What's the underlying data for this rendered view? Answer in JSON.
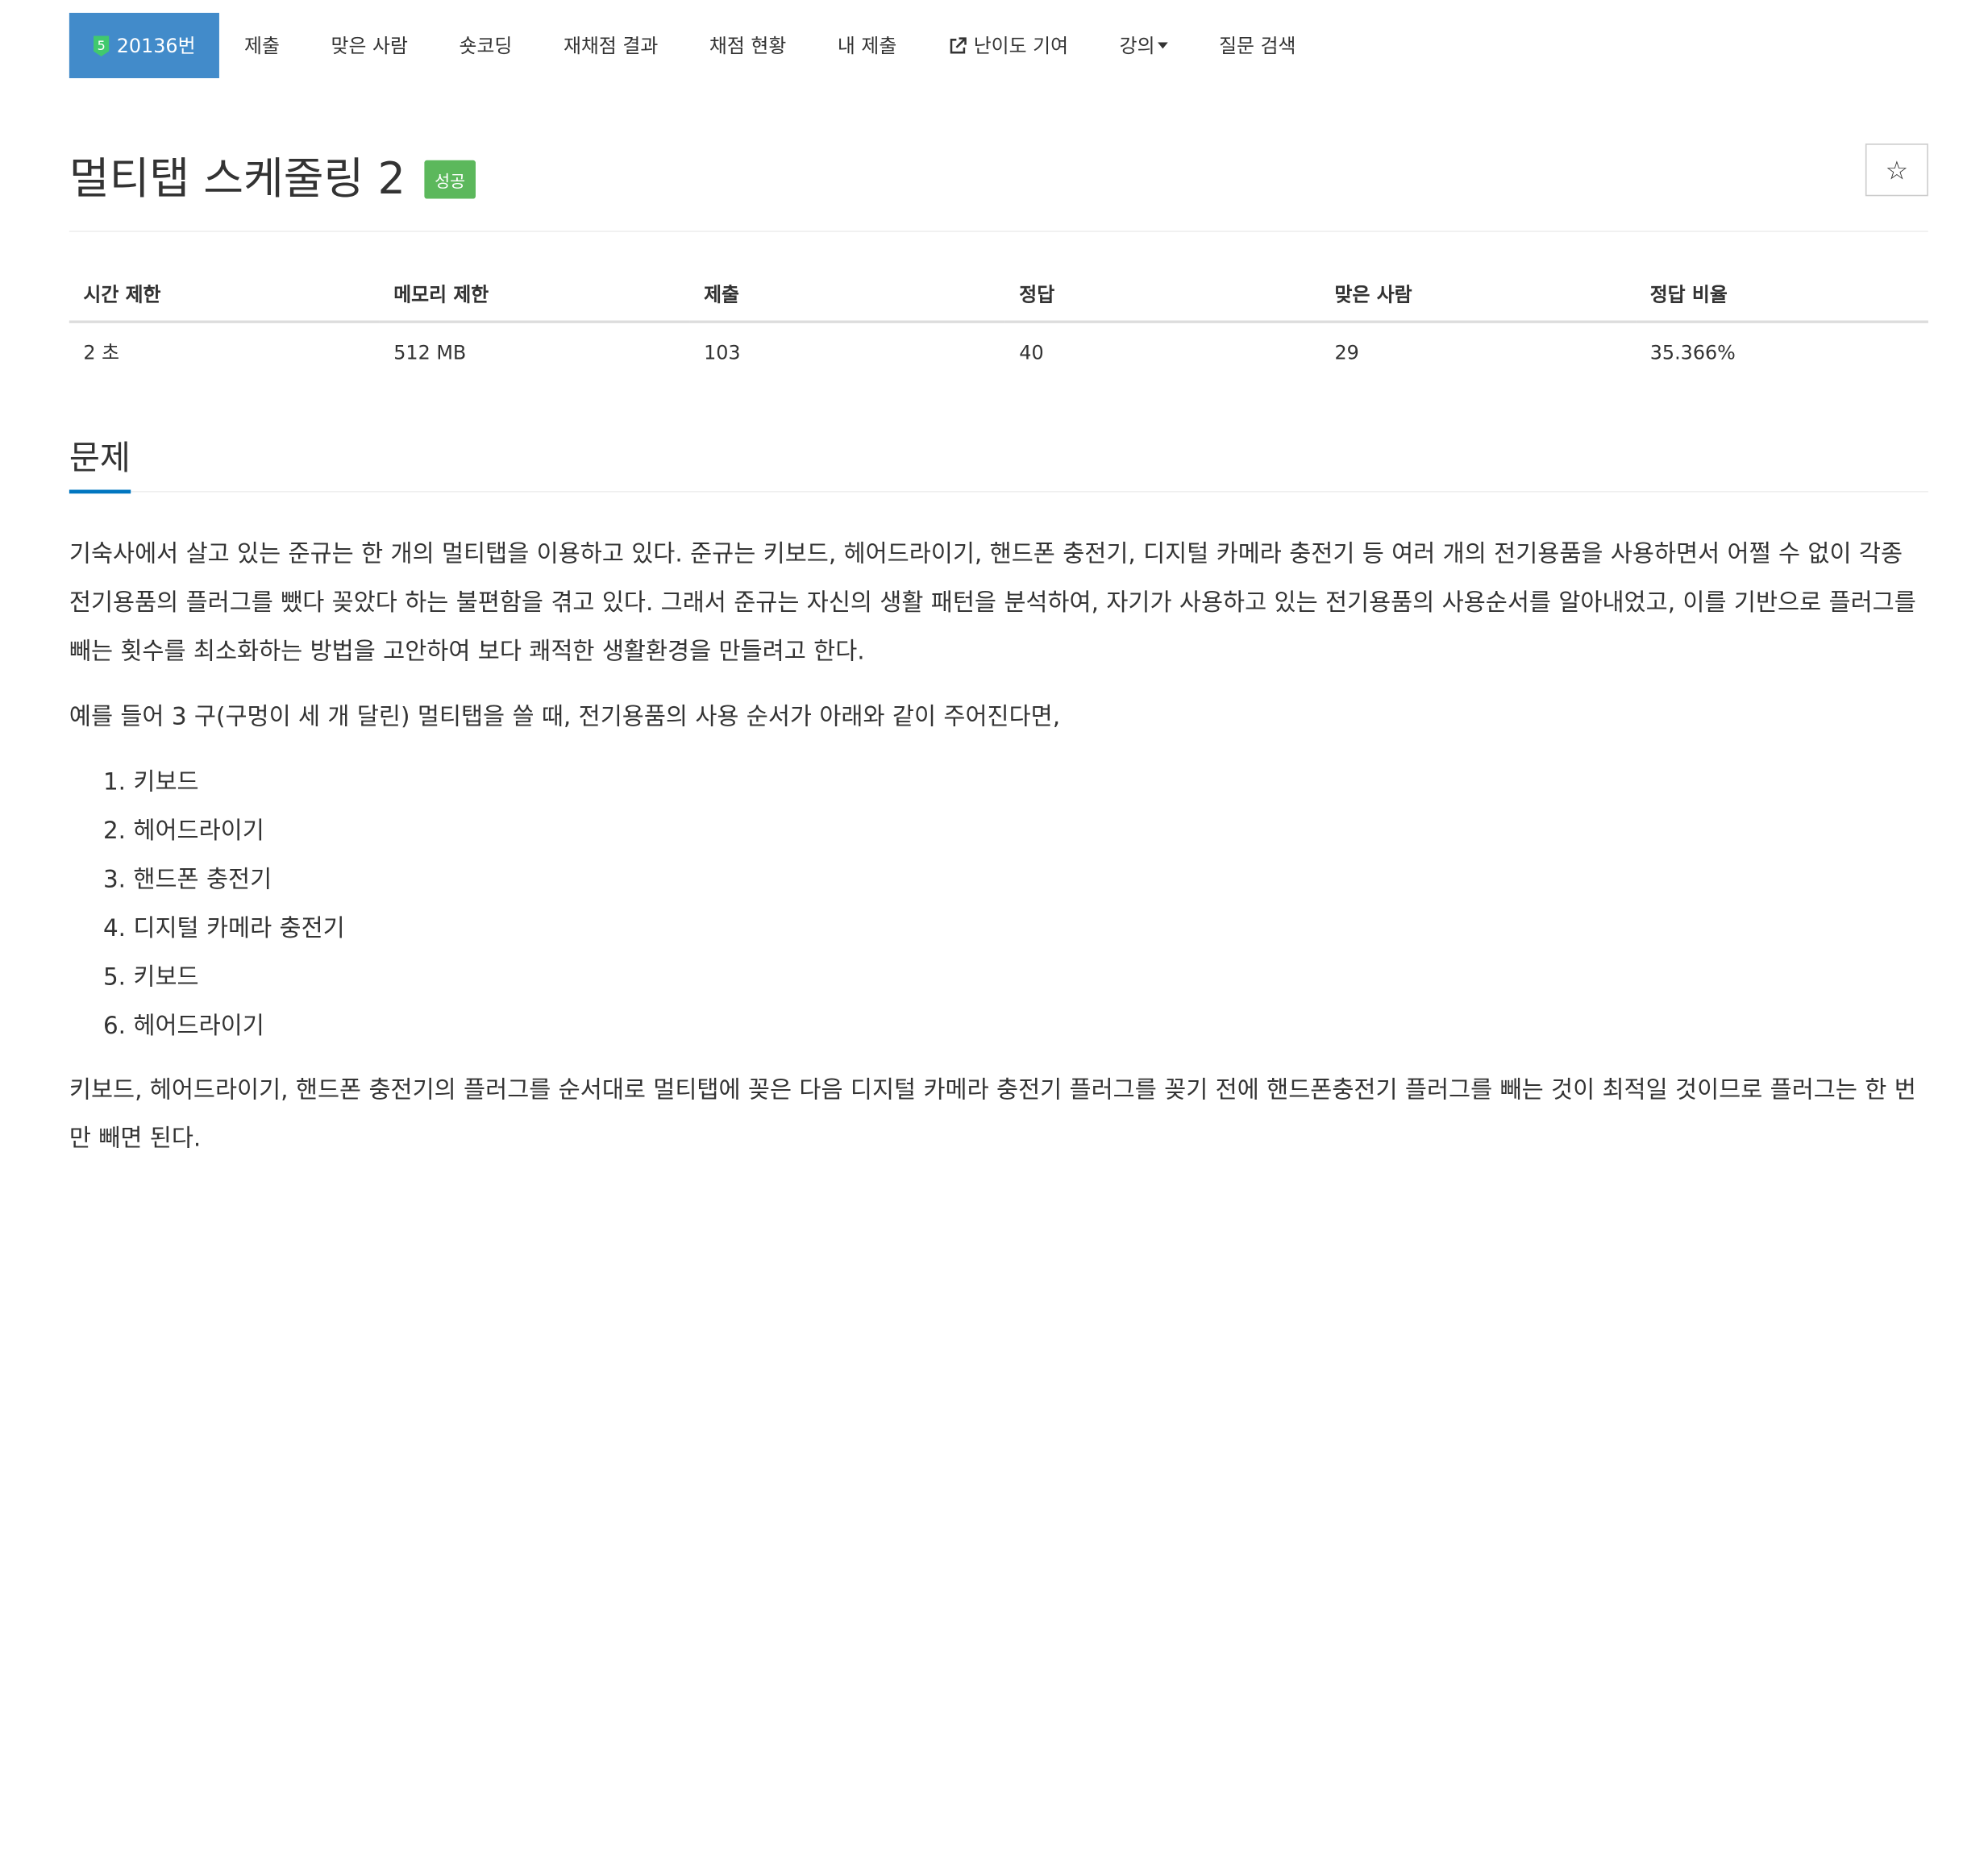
{
  "nav": {
    "problem_id": "20136번",
    "level": "5",
    "tabs": [
      "제출",
      "맞은 사람",
      "숏코딩",
      "재채점 결과",
      "채점 현황",
      "내 제출"
    ],
    "difficulty": "난이도 기여",
    "lecture": "강의",
    "question_search": "질문 검색"
  },
  "title": "멀티탭 스케줄링 2",
  "status_badge": "성공",
  "star": "☆",
  "info": {
    "headers": [
      "시간 제한",
      "메모리 제한",
      "제출",
      "정답",
      "맞은 사람",
      "정답 비율"
    ],
    "values": [
      "2 초",
      "512 MB",
      "103",
      "40",
      "29",
      "35.366%"
    ]
  },
  "section_title": "문제",
  "description": {
    "p1": "기숙사에서 살고 있는 준규는 한 개의 멀티탭을 이용하고 있다. 준규는 키보드, 헤어드라이기, 핸드폰 충전기, 디지털 카메라 충전기 등 여러 개의 전기용품을 사용하면서 어쩔 수 없이 각종 전기용품의 플러그를 뺐다 꽂았다 하는 불편함을 겪고 있다. 그래서 준규는 자신의 생활 패턴을 분석하여, 자기가 사용하고 있는 전기용품의 사용순서를 알아내었고, 이를 기반으로 플러그를 빼는 횟수를 최소화하는 방법을 고안하여 보다 쾌적한 생활환경을 만들려고 한다.",
    "p2": "예를 들어 3 구(구멍이 세 개 달린) 멀티탭을 쓸 때, 전기용품의 사용 순서가 아래와 같이 주어진다면,",
    "list": [
      "키보드",
      "헤어드라이기",
      "핸드폰 충전기",
      "디지털 카메라 충전기",
      "키보드",
      "헤어드라이기"
    ],
    "p3": "키보드, 헤어드라이기, 핸드폰 충전기의 플러그를 순서대로 멀티탭에 꽂은 다음 디지털 카메라 충전기 플러그를 꽂기 전에 핸드폰충전기 플러그를 빼는 것이 최적일 것이므로 플러그는 한 번만 빼면 된다."
  },
  "colors": {
    "active_tab": "#428bca",
    "success_badge": "#5cb85c",
    "section_underline": "#0076c0"
  }
}
